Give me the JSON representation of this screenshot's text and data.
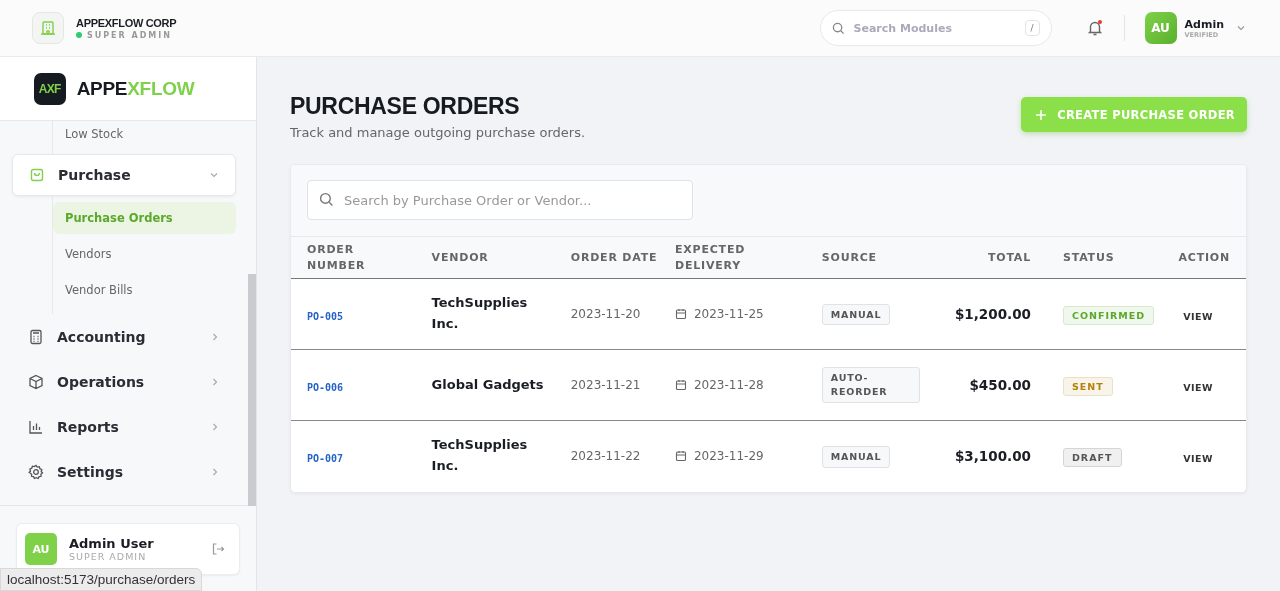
{
  "header": {
    "company": "APPEXFLOW CORP",
    "role": "SUPER ADMIN",
    "online": true,
    "search": {
      "placeholder": "Search Modules",
      "shortcut": "/"
    },
    "notifications_unread": true,
    "user": {
      "initials": "AU",
      "name": "Admin",
      "status": "VERIFIED"
    }
  },
  "sidebar": {
    "logo_mark": "AXF",
    "logo_text": "APPE",
    "logo_text_accent": "XFLOW",
    "items": [
      {
        "label": "Low Stock",
        "kind": "subitem",
        "selected": false
      },
      {
        "label": "Purchase",
        "kind": "group",
        "expanded": true,
        "children": [
          {
            "label": "Purchase Orders",
            "selected": true
          },
          {
            "label": "Vendors",
            "selected": false
          },
          {
            "label": "Vendor Bills",
            "selected": false
          }
        ]
      },
      {
        "label": "Accounting",
        "kind": "group",
        "expanded": false
      },
      {
        "label": "Operations",
        "kind": "group",
        "expanded": false
      },
      {
        "label": "Reports",
        "kind": "group",
        "expanded": false
      },
      {
        "label": "Settings",
        "kind": "group",
        "expanded": false
      }
    ],
    "user_card": {
      "initials": "AU",
      "name": "Admin User",
      "role": "SUPER ADMIN"
    }
  },
  "status_url": "localhost:5173/purchase/orders",
  "page": {
    "title": "PURCHASE ORDERS",
    "subtitle": "Track and manage outgoing purchase orders.",
    "create_button": "CREATE PURCHASE ORDER"
  },
  "table": {
    "search": {
      "placeholder": "Search by Purchase Order or Vendor..."
    },
    "columns": [
      "ORDER NUMBER",
      "VENDOR",
      "ORDER DATE",
      "EXPECTED DELIVERY",
      "SOURCE",
      "TOTAL",
      "STATUS",
      "ACTION"
    ],
    "rows": [
      {
        "order_number": "PO-005",
        "vendor": "TechSupplies Inc.",
        "order_date": "2023-11-20",
        "expected_delivery": "2023-11-25",
        "source": "MANUAL",
        "total": "$1,200.00",
        "status": "CONFIRMED",
        "color": "#5aa92a",
        "action": "VIEW"
      },
      {
        "order_number": "PO-006",
        "vendor": "Global Gadgets",
        "order_date": "2023-11-21",
        "expected_delivery": "2023-11-28",
        "source": "AUTO-REORDER",
        "total": "$450.00",
        "status": "SENT",
        "color": "#b5810c",
        "action": "VIEW"
      },
      {
        "order_number": "PO-007",
        "vendor": "TechSupplies Inc.",
        "order_date": "2023-11-22",
        "expected_delivery": "2023-11-29",
        "source": "MANUAL",
        "total": "$3,100.00",
        "status": "DRAFT",
        "color": "#555555",
        "action": "VIEW"
      }
    ]
  }
}
